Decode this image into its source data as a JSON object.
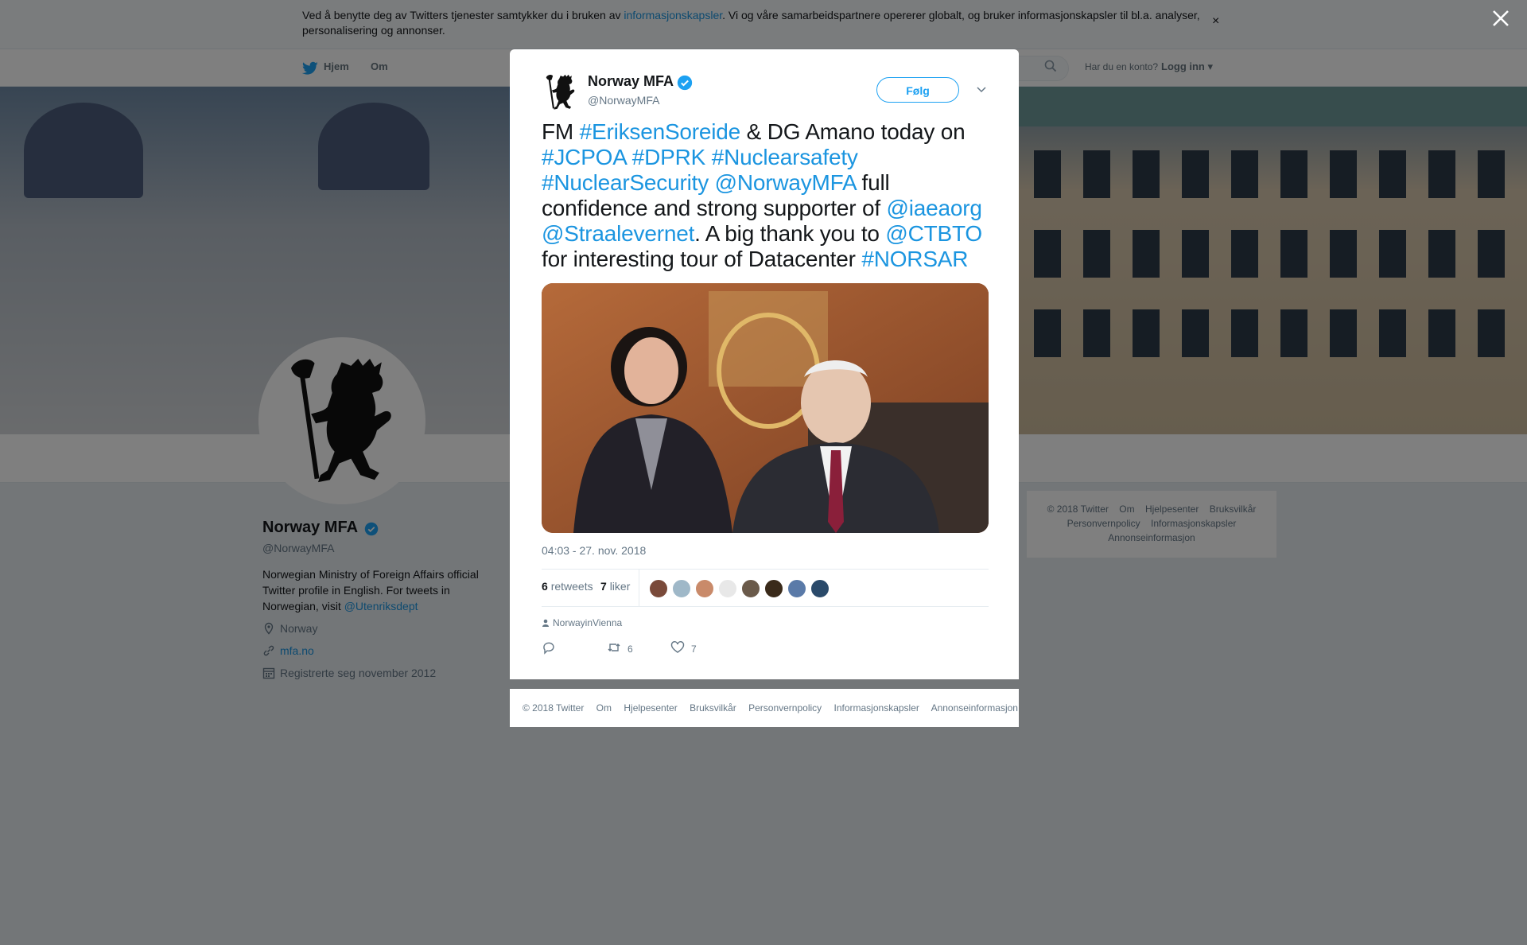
{
  "cookie_banner": {
    "text_before": "Ved å benytte deg av Twitters tjenester samtykker du i bruken av ",
    "link": "informasjonskapsler",
    "text_after": ". Vi og våre samarbeidspartnere opererer globalt, og bruker informasjonskapsler til bl.a. analyser, personalisering og annonser.",
    "close": "×"
  },
  "topnav": {
    "home": "Hjem",
    "about": "Om",
    "login_prompt": "Har du en konto?",
    "login": "Logg inn"
  },
  "profile": {
    "name": "Norway MFA",
    "handle": "@NorwayMFA",
    "bio": "Norwegian Ministry of Foreign Affairs official Twitter profile in English. For tweets in Norwegian, visit ",
    "bio_link": "@Utenriksdept",
    "location": "Norway",
    "website": "mfa.no",
    "joined": "Registrerte seg november 2012"
  },
  "side_footer": {
    "row1": [
      "© 2018 Twitter",
      "Om",
      "Hjelpesenter",
      "Bruksvilkår"
    ],
    "row2": [
      "Personvernpolicy",
      "Informasjonskapsler"
    ],
    "row3": [
      "Annonseinformasjon"
    ]
  },
  "tweet": {
    "name": "Norway MFA",
    "handle": "@NorwayMFA",
    "follow": "Følg",
    "segments": [
      {
        "t": "FM ",
        "link": false
      },
      {
        "t": "#EriksenSoreide",
        "link": true
      },
      {
        "t": " & DG Amano today on ",
        "link": false
      },
      {
        "t": "#JCPOA",
        "link": true
      },
      {
        "t": " ",
        "link": false
      },
      {
        "t": "#DPRK",
        "link": true
      },
      {
        "t": " ",
        "link": false
      },
      {
        "t": "#Nuclearsafety",
        "link": true
      },
      {
        "t": " ",
        "link": false
      },
      {
        "t": "#NuclearSecurity",
        "link": true
      },
      {
        "t": " ",
        "link": false
      },
      {
        "t": "@NorwayMFA",
        "link": true
      },
      {
        "t": " full confidence and strong supporter of ",
        "link": false
      },
      {
        "t": "@iaeaorg",
        "link": true
      },
      {
        "t": " ",
        "link": false
      },
      {
        "t": "@Straalevernet",
        "link": true
      },
      {
        "t": ". A big thank you to ",
        "link": false
      },
      {
        "t": "@CTBTO",
        "link": true
      },
      {
        "t": " for interesting tour of Datacenter ",
        "link": false
      },
      {
        "t": "#NORSAR",
        "link": true
      }
    ],
    "timestamp": "04:03 - 27. nov. 2018",
    "retweets_count": "6",
    "retweets_label": "retweets",
    "likes_count": "7",
    "likes_label": "liker",
    "retweeter_colors": [
      "#7a4a3a",
      "#9fb8c8",
      "#c98a6a",
      "#e8e8e8",
      "#6a5a4a",
      "#3a2a1a",
      "#5a7aa8",
      "#2a4a6a"
    ],
    "context": "NorwayinVienna",
    "action_retweet_count": "6",
    "action_like_count": "7"
  },
  "modal_footer": [
    "© 2018 Twitter",
    "Om",
    "Hjelpesenter",
    "Bruksvilkår",
    "Personvernpolicy",
    "Informasjonskapsler",
    "Annonseinformasjon"
  ],
  "colors": {
    "link": "#1b95e0",
    "accent": "#1da1f2",
    "overlay": "rgba(0,0,0,0.5)"
  }
}
